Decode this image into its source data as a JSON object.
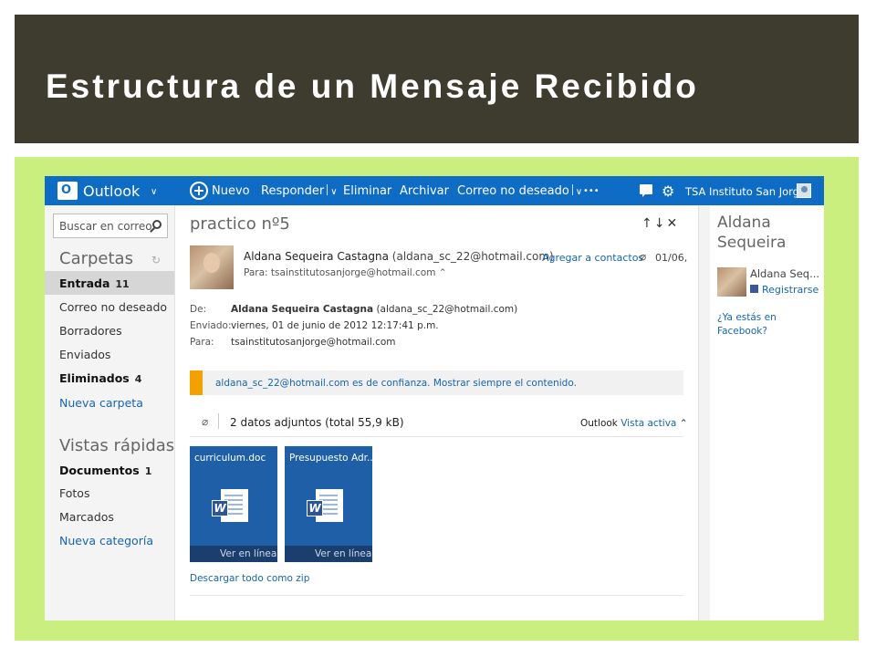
{
  "slide": {
    "title": "Estructura de un Mensaje Recibido"
  },
  "topbar": {
    "app_name": "Outlook",
    "actions": {
      "new": "Nuevo",
      "reply": "Responder",
      "delete": "Eliminar",
      "archive": "Archivar",
      "junk": "Correo no deseado",
      "more": "•••"
    },
    "account": "TSA Instituto San Jorge"
  },
  "leftnav": {
    "search_placeholder": "Buscar en correo",
    "folders_heading": "Carpetas",
    "folders": [
      {
        "label": "Entrada",
        "count": "11"
      },
      {
        "label": "Correo no deseado",
        "count": ""
      },
      {
        "label": "Borradores",
        "count": ""
      },
      {
        "label": "Enviados",
        "count": ""
      },
      {
        "label": "Eliminados",
        "count": "4"
      }
    ],
    "new_folder": "Nueva carpeta",
    "quick_views_heading": "Vistas rápidas",
    "quick_views": [
      {
        "label": "Documentos",
        "count": "1"
      },
      {
        "label": "Fotos",
        "count": ""
      },
      {
        "label": "Marcados",
        "count": ""
      }
    ],
    "new_category": "Nueva categoría"
  },
  "message": {
    "subject": "practico nº5",
    "sender_name": "Aldana Sequeira Castagna",
    "sender_email": "(aldana_sc_22@hotmail.com)",
    "add_contact": "Agregar a contactos",
    "date": "01/06,",
    "to_line": "Para: tsainstitutosanjorge@hotmail.com",
    "headers": {
      "from_label": "De:",
      "from_name": "Aldana Sequeira Castagna",
      "from_email": "(aldana_sc_22@hotmail.com)",
      "sent_label": "Enviado:",
      "sent_value": "viernes, 01 de junio de 2012 12:17:41 p.m.",
      "to_label": "Para:",
      "to_value": "tsainstitutosanjorge@hotmail.com"
    },
    "trust_notice": "aldana_sc_22@hotmail.com es de confianza. Mostrar siempre el contenido.",
    "attachments_summary": "2 datos adjuntos (total 55,9 kB)",
    "view_prefix": "Outlook",
    "view_link": "Vista activa",
    "attachments": [
      {
        "name": "curriculum.doc",
        "action": "Ver en línea"
      },
      {
        "name": "Presupuesto Adr...",
        "action": "Ver en línea"
      }
    ],
    "download_all": "Descargar todo como zip"
  },
  "contact_pane": {
    "name": "Aldana Sequeira",
    "short_name": "Aldana Seq...",
    "register": "Registrarse",
    "facebook_prompt": "¿Ya estás en Facebook?"
  },
  "colors": {
    "title_bar": "#3e3c2f",
    "panel": "#cbef7e",
    "outlook_blue": "#0f6cc5",
    "tile": "#1f5fa8",
    "accent": "#f2a100"
  }
}
